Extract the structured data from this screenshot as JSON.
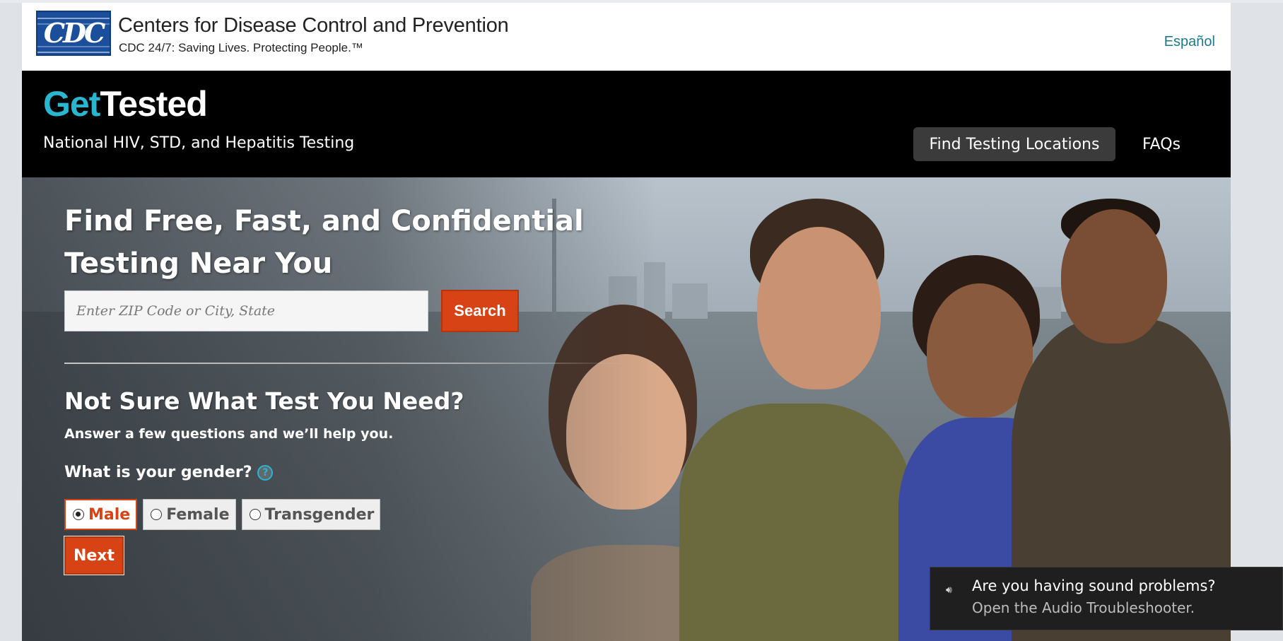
{
  "cdc_header": {
    "logo_text": "CDC",
    "title": "Centers for Disease Control and Prevention",
    "tagline": "CDC 24/7: Saving Lives. Protecting People.™",
    "language_link": "Español"
  },
  "banner": {
    "logo_get": "Get",
    "logo_tested": "Tested",
    "subtitle": "National HIV, STD, and Hepatitis Testing",
    "nav": [
      {
        "label": "Find Testing Locations",
        "active": true
      },
      {
        "label": "FAQs",
        "active": false
      }
    ]
  },
  "hero": {
    "title": "Find Free, Fast, and Confidential Testing Near You",
    "search": {
      "placeholder": "Enter ZIP Code or City, State",
      "value": "",
      "button_label": "Search"
    },
    "quiz": {
      "heading": "Not Sure What Test You Need?",
      "subheading": "Answer a few questions and we’ll help you.",
      "question": "What is your gender?",
      "help_icon": "?",
      "options": [
        {
          "label": "Male",
          "selected": true
        },
        {
          "label": "Female",
          "selected": false
        },
        {
          "label": "Transgender",
          "selected": false
        }
      ],
      "next_label": "Next"
    }
  },
  "toast": {
    "icon": "speaker-icon",
    "title": "Are you having sound problems?",
    "message": "Open the Audio Troubleshooter."
  },
  "colors": {
    "accent_orange": "#d84315",
    "brand_teal": "#29b6cf",
    "link_teal": "#1b7a8a",
    "banner_bg": "#000000"
  }
}
